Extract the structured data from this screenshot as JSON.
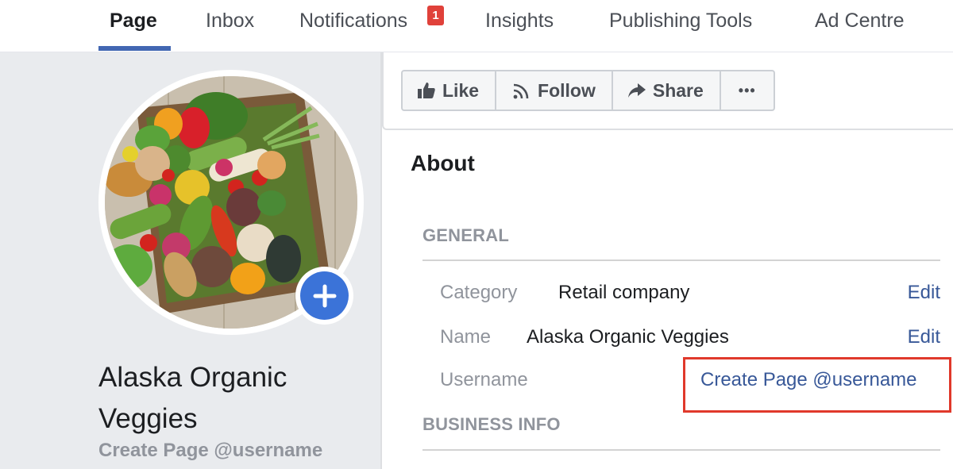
{
  "topnav": {
    "tabs": [
      {
        "label": "Page",
        "active": true
      },
      {
        "label": "Inbox",
        "active": false
      },
      {
        "label": "Notifications",
        "active": false,
        "badge": "1"
      },
      {
        "label": "Insights",
        "active": false
      },
      {
        "label": "Publishing Tools",
        "active": false
      },
      {
        "label": "Ad Centre",
        "active": false
      }
    ],
    "accent_color": "#4267b2",
    "badge_color": "#e0413a"
  },
  "profile": {
    "page_name": "Alaska Organic Veggies",
    "username_link": "Create Page @username",
    "photo_icon": "vegetable-box-photo",
    "add_photo_icon": "plus-icon"
  },
  "actions": {
    "like_label": "Like",
    "follow_label": "Follow",
    "share_label": "Share",
    "more_label": "•••"
  },
  "about": {
    "title": "About",
    "sections": {
      "general": "GENERAL",
      "business_info": "BUSINESS INFO"
    },
    "rows": [
      {
        "label": "Category",
        "value": "Retail company",
        "action": "Edit"
      },
      {
        "label": "Name",
        "value": "Alaska Organic Veggies",
        "action": "Edit"
      },
      {
        "label": "Username",
        "value": "",
        "action": "Create Page @username"
      }
    ],
    "link_color": "#385898",
    "highlight_color": "#e0392b"
  }
}
